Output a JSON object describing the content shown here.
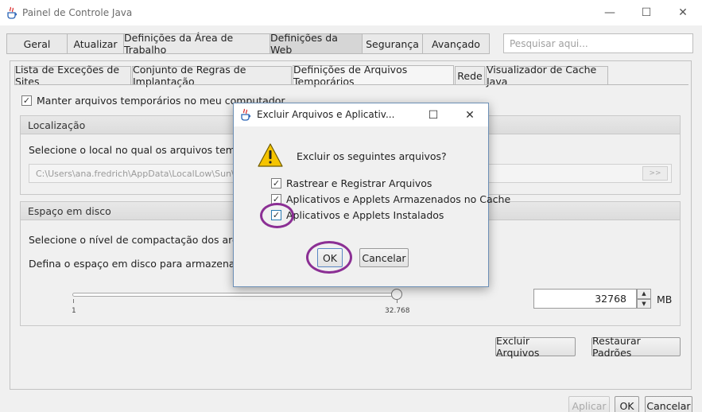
{
  "window": {
    "title": "Painel de Controle Java",
    "controls": {
      "minimize": "—",
      "maximize": "☐",
      "close": "✕"
    }
  },
  "main_tabs": [
    "Geral",
    "Atualizar",
    "Definições da Área de Trabalho",
    "Definições da Web",
    "Segurança",
    "Avançado"
  ],
  "active_main_tab": "Definições da Web",
  "search": {
    "placeholder": "Pesquisar aqui..."
  },
  "sub_tabs": [
    "Lista de Exceções de Sites",
    "Conjunto de Regras de Implantação",
    "Definições de Arquivos Temporários",
    "Rede",
    "Visualizador de Cache Java"
  ],
  "active_sub_tab": "Definições de Arquivos Temporários",
  "keep_temp": {
    "label": "Manter arquivos temporários no meu computador.",
    "checked": true
  },
  "location": {
    "header": "Localização",
    "description": "Selecione o local no qual os arquivos temporário",
    "path": "C:\\Users\\ana.fredrich\\AppData\\LocalLow\\Sun\\J",
    "browse": ">>"
  },
  "disk": {
    "header": "Espaço em disco",
    "compression_label": "Selecione o nível de compactação dos arquivos J",
    "space_label": "Defina o espaço em disco para armazenamento d",
    "slider": {
      "min_label": "1",
      "max_label": "32.768",
      "value_fraction": 1.0
    },
    "value": "32768",
    "unit": "MB"
  },
  "buttons": {
    "delete_files": "Excluir Arquivos",
    "restore_defaults": "Restaurar Padrões",
    "apply": "Aplicar",
    "ok": "OK",
    "cancel": "Cancelar"
  },
  "dialog": {
    "title": "Excluir Arquivos e Aplicativ...",
    "controls": {
      "maximize": "☐",
      "close": "✕"
    },
    "question": "Excluir os seguintes arquivos?",
    "options": [
      {
        "label": "Rastrear e Registrar Arquivos",
        "checked": true
      },
      {
        "label": "Aplicativos e Applets Armazenados no Cache",
        "checked": true
      },
      {
        "label": "Aplicativos e Applets Instalados",
        "checked": true
      }
    ],
    "ok": "OK",
    "cancel": "Cancelar"
  },
  "colors": {
    "annotation": "#8b2f94",
    "warning": "#f5c400",
    "dialog_border": "#6c8fb6"
  }
}
